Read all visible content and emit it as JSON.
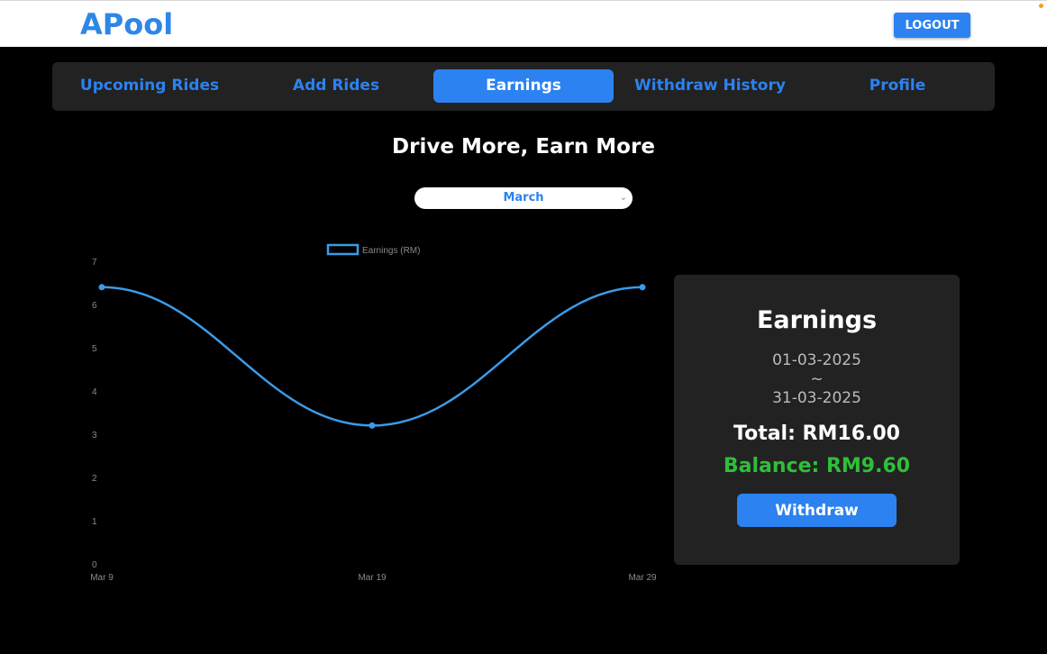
{
  "app": {
    "logo": "APool",
    "logout_label": "LOGOUT"
  },
  "nav": {
    "items": [
      {
        "label": "Upcoming Rides",
        "active": false
      },
      {
        "label": "Add Rides",
        "active": false
      },
      {
        "label": "Earnings",
        "active": true
      },
      {
        "label": "Withdraw History",
        "active": false
      },
      {
        "label": "Profile",
        "active": false
      }
    ]
  },
  "main": {
    "headline": "Drive More, Earn More",
    "month_select": {
      "value": "March"
    }
  },
  "card": {
    "title": "Earnings",
    "start_date": "01-03-2025",
    "separator": "~",
    "end_date": "31-03-2025",
    "total": "Total: RM16.00",
    "balance": "Balance: RM9.60",
    "withdraw_label": "Withdraw"
  },
  "colors": {
    "accent": "#2b82f0",
    "balance_green": "#2fbf3a",
    "panel": "#222222",
    "background": "#000000"
  },
  "chart_data": {
    "type": "line",
    "x": [
      "Mar 9",
      "Mar 19",
      "Mar 29"
    ],
    "series": [
      {
        "name": "Earnings (RM)",
        "values": [
          6.4,
          3.2,
          6.4
        ],
        "color": "#3b9be8"
      }
    ],
    "yticks": [
      0,
      1,
      2,
      3,
      4,
      5,
      6,
      7
    ],
    "ylim": [
      0,
      7
    ],
    "grid": false,
    "legend": "top",
    "smooth": true
  }
}
